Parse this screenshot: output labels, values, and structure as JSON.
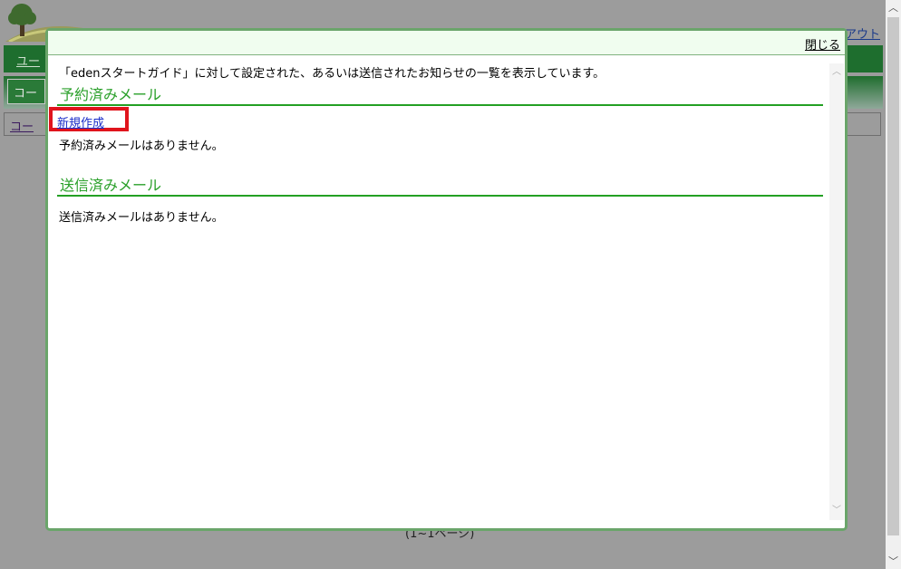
{
  "background": {
    "logout_link": "アウト",
    "nav1_label": "ユー",
    "nav2_tab": "コー",
    "box_label": "コー",
    "page_indicator": "(1~1ページ)"
  },
  "modal": {
    "close_label": "閉じる",
    "intro_text": "「edenスタートガイド」に対して設定された、あるいは送信されたお知らせの一覧を表示しています。",
    "scheduled": {
      "heading": "予約済みメール",
      "new_link": "新規作成",
      "empty_text": "予約済みメールはありません。"
    },
    "sent": {
      "heading": "送信済みメール",
      "empty_text": "送信済みメールはありません。"
    }
  },
  "colors": {
    "accent_green": "#2aa02a",
    "highlight_red": "#e0141c",
    "link_blue": "#1a2cc8"
  }
}
